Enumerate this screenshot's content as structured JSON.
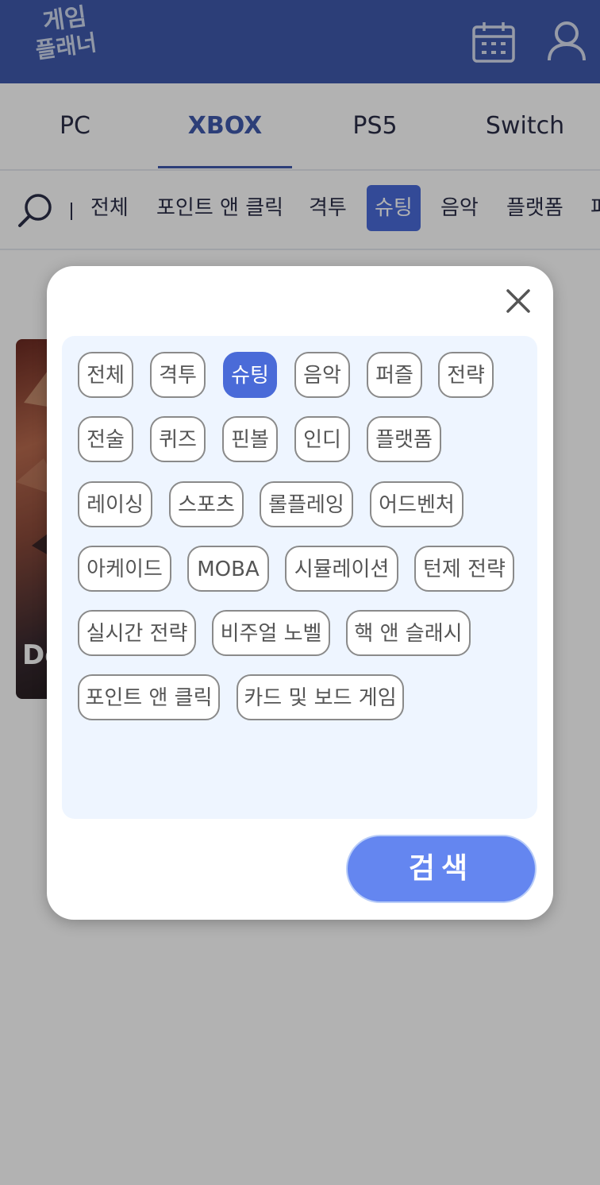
{
  "header": {
    "logo_line1": "게임",
    "logo_line2": "플래너"
  },
  "platform_tabs": [
    {
      "label": "PC"
    },
    {
      "label": "XBOX"
    },
    {
      "label": "PS5"
    },
    {
      "label": "Switch"
    }
  ],
  "genre_bar": [
    {
      "label": "전체"
    },
    {
      "label": "포인트 앤 클릭"
    },
    {
      "label": "격투"
    },
    {
      "label": "슈팅"
    },
    {
      "label": "음악"
    },
    {
      "label": "플랫폼"
    },
    {
      "label": "퍼"
    }
  ],
  "game_card": {
    "title": "De"
  },
  "modal": {
    "chips": [
      {
        "label": "전체"
      },
      {
        "label": "격투"
      },
      {
        "label": "슈팅"
      },
      {
        "label": "음악"
      },
      {
        "label": "퍼즐"
      },
      {
        "label": "전략"
      },
      {
        "label": "전술"
      },
      {
        "label": "퀴즈"
      },
      {
        "label": "핀볼"
      },
      {
        "label": "인디"
      },
      {
        "label": "플랫폼"
      },
      {
        "label": "레이싱"
      },
      {
        "label": "스포츠"
      },
      {
        "label": "롤플레잉"
      },
      {
        "label": "어드벤처"
      },
      {
        "label": "아케이드"
      },
      {
        "label": "MOBA"
      },
      {
        "label": "시뮬레이션"
      },
      {
        "label": "턴제 전략"
      },
      {
        "label": "실시간 전략"
      },
      {
        "label": "비주얼 노벨"
      },
      {
        "label": "핵 앤 슬래시"
      },
      {
        "label": "포인트 앤 클릭"
      },
      {
        "label": "카드 및 보드 게임"
      }
    ],
    "search_label": "검색"
  },
  "colors": {
    "header_bg": "#3f5aad",
    "accent": "#4a6bd8",
    "search_button": "#6486f0",
    "chip_area_bg": "#eef5ff"
  }
}
